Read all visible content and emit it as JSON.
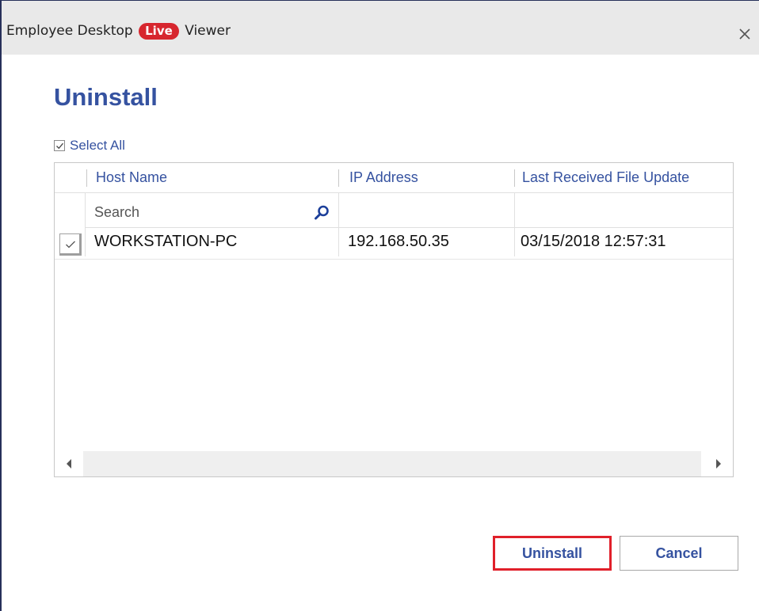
{
  "window": {
    "title_prefix": "Employee Desktop",
    "title_badge": "Live",
    "title_suffix": "Viewer",
    "close_glyph": "×"
  },
  "heading": "Uninstall",
  "select_all": {
    "label": "Select All",
    "checked": true
  },
  "table": {
    "columns": [
      "Host Name",
      "IP Address",
      "Last Received File Update"
    ],
    "search_placeholder": "Search",
    "rows": [
      {
        "checked": true,
        "host": "WORKSTATION-PC",
        "ip": "192.168.50.35",
        "last_update": "03/15/2018 12:57:31"
      }
    ]
  },
  "buttons": {
    "uninstall": "Uninstall",
    "cancel": "Cancel"
  },
  "colors": {
    "accent": "#3552a0",
    "badge": "#d7262e",
    "highlight": "#e0202a"
  },
  "icons": [
    "close-icon",
    "checkmark-icon",
    "search-icon",
    "scroll-left-arrow-icon",
    "scroll-right-arrow-icon"
  ]
}
